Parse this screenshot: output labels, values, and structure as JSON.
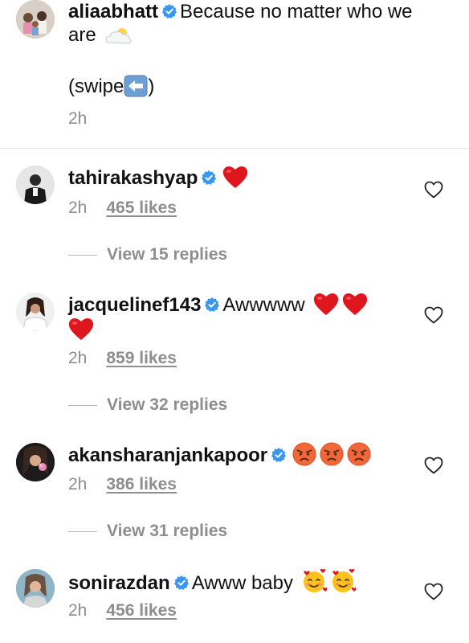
{
  "post_caption": {
    "username": "aliaabhatt",
    "text_line1": "Because no matter who we",
    "text_line2": "are",
    "swipe_open": "(swipe",
    "swipe_close": ")",
    "time": "2h"
  },
  "comments": [
    {
      "username": "tahirakashyap",
      "text": "",
      "time": "2h",
      "likes": "465 likes",
      "view_replies": "View 15 replies"
    },
    {
      "username": "jacquelinef143",
      "text": "Awwwww",
      "time": "2h",
      "likes": "859 likes",
      "view_replies": "View 32 replies"
    },
    {
      "username": "akansharanjankapoor",
      "text": "",
      "time": "2h",
      "likes": "386 likes",
      "view_replies": "View 31 replies"
    },
    {
      "username": "sonirazdan",
      "text": "Awww baby",
      "time": "2h",
      "likes": "456 likes"
    }
  ],
  "colors": {
    "verified_blue": "#3897f0",
    "secondary_text": "#8e8e8e",
    "heart_red": "#e0161e"
  },
  "icons": [
    "verified-badge-icon",
    "heart-emoji-icon",
    "angry-face-emoji-icon",
    "smiling-hearts-emoji-icon",
    "like-heart-outline-icon",
    "cloud-sun-emoji-icon",
    "left-arrow-emoji-icon"
  ]
}
